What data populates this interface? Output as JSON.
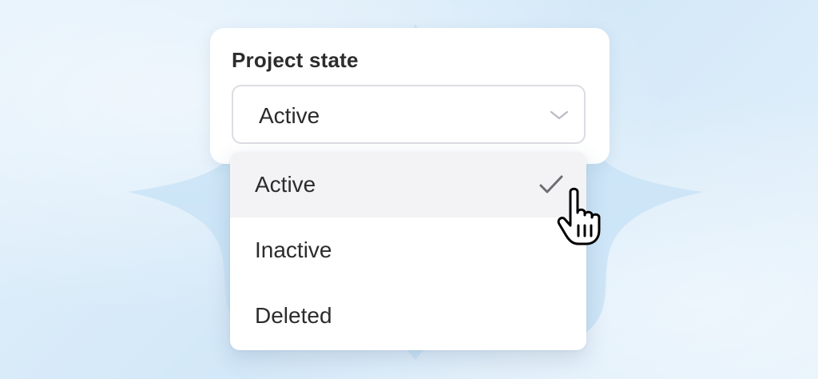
{
  "colors": {
    "background": "#d8ebf9",
    "background_shape": "#c6e1f6",
    "card": "#ffffff",
    "select_border": "#dcdde3",
    "selected_item_bg": "#f3f3f5",
    "text": "#2c2c2c",
    "chevron": "#b9bcc4",
    "check": "#6e6e73"
  },
  "field": {
    "label": "Project state",
    "value": "Active",
    "chevron_icon": "chevron-down-icon"
  },
  "dropdown": {
    "options": [
      {
        "label": "Active",
        "selected": true
      },
      {
        "label": "Inactive",
        "selected": false
      },
      {
        "label": "Deleted",
        "selected": false
      }
    ],
    "check_icon": "checkmark-icon"
  },
  "pointer": {
    "icon": "hand-pointer-cursor-icon"
  }
}
